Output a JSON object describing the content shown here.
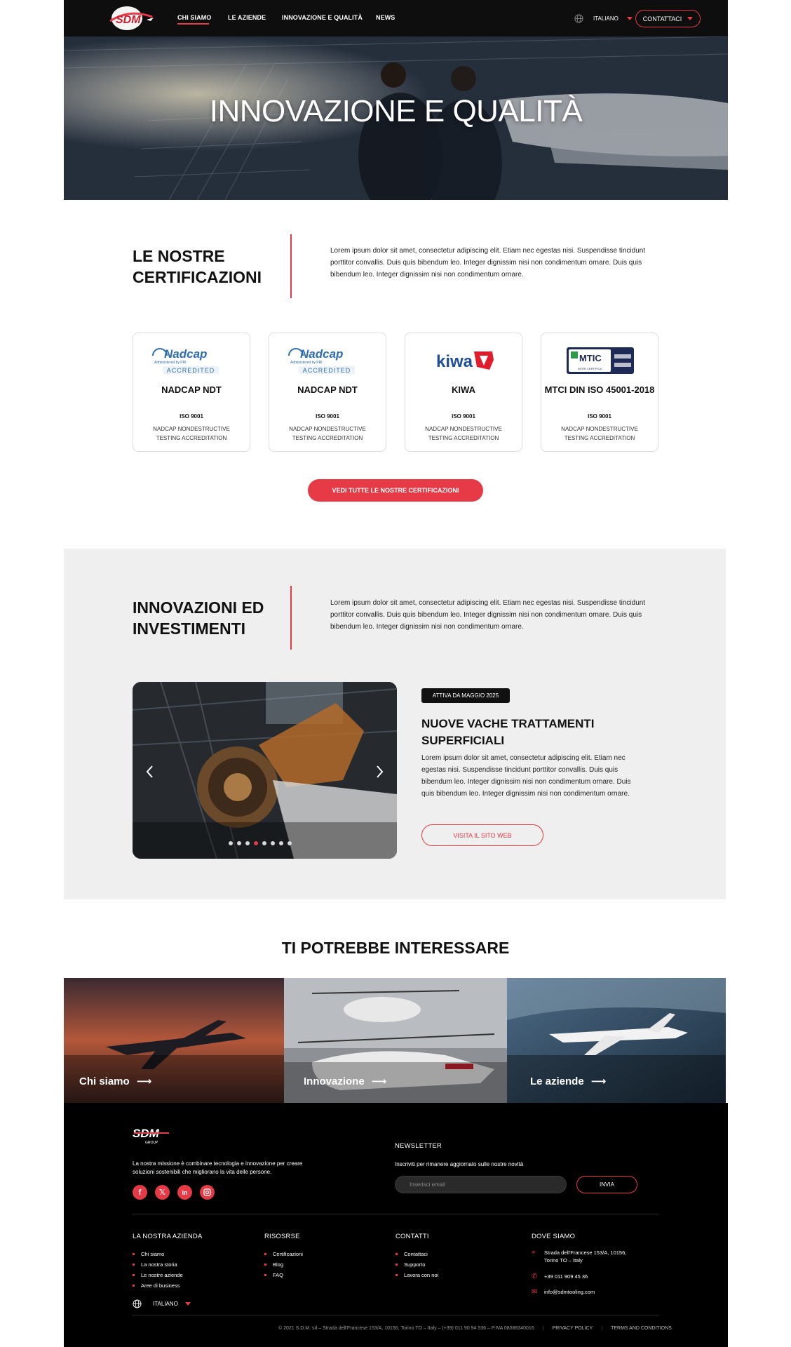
{
  "header": {
    "nav": [
      "CHI SIAMO",
      "LE AZIENDE",
      "INNOVAZIONE E QUALITÀ",
      "NEWS"
    ],
    "language": "ITALIANO",
    "contact_label": "CONTATTACI"
  },
  "hero": {
    "title": "INNOVAZIONE E QUALITÀ"
  },
  "certifications": {
    "title_line1": "LE NOSTRE",
    "title_line2": "CERTIFICAZIONI",
    "lead": "Lorem ipsum dolor sit amet, consectetur adipiscing elit. Etiam nec egestas nisi. Suspendisse tincidunt porttitor convallis. Duis quis bibendum leo. Integer dignissim nisi non condimentum ornare.  Duis quis bibendum leo. Integer dignissim nisi non condimentum ornare.",
    "cards": [
      {
        "logo_text": "Nadcap",
        "logo_sub": "Administered by PRI",
        "logo_badge": "ACCREDITED",
        "name": "NADCAP NDT",
        "iso": "ISO 9001",
        "desc": "NADCAP NONDESTRUCTIVE TESTING ACCREDITATION"
      },
      {
        "logo_text": "Nadcap",
        "logo_sub": "Administered by PRI",
        "logo_badge": "ACCREDITED",
        "name": "NADCAP NDT",
        "iso": "ISO 9001",
        "desc": "NADCAP NONDESTRUCTIVE TESTING ACCREDITATION"
      },
      {
        "logo_text": "kiwa",
        "name": "KIWA",
        "iso": "ISO 9001",
        "desc": "NADCAP NONDESTRUCTIVE TESTING ACCREDITATION"
      },
      {
        "logo_text": "MTIC",
        "logo_sub": "INTER CERTIFICA",
        "name": "MTCI DIN ISO 45001-2018",
        "iso": "ISO 9001",
        "desc": "NADCAP NONDESTRUCTIVE TESTING ACCREDITATION"
      }
    ],
    "all_button": "VEDI TUTTE LE NOSTRE CERTIFICAZIONI"
  },
  "innovation": {
    "title_line1": "INNOVAZIONI ED",
    "title_line2": "INVESTIMENTI",
    "lead": "Lorem ipsum dolor sit amet, consectetur adipiscing elit. Etiam nec egestas nisi. Suspendisse tincidunt porttitor convallis. Duis quis bibendum leo. Integer dignissim nisi non condimentum ornare.  Duis quis bibendum leo. Integer dignissim nisi non condimentum ornare.",
    "badge": "ATTIVA DA MAGGIO 2025",
    "news_title": "NUOVE VACHE TRATTAMENTI SUPERFICIALI",
    "news_text": "Lorem ipsum dolor sit amet, consectetur adipiscing elit. Etiam nec egestas nisi. Suspendisse tincidunt porttitor convallis. Duis quis bibendum leo. Integer dignissim nisi non condimentum ornare.  Duis quis bibendum leo. Integer dignissim nisi non condimentum ornare.",
    "news_button": "VISITA IL  SITO WEB",
    "slides_count": 8,
    "active_slide": 4
  },
  "interest": {
    "title": "TI POTREBBE INTERESSARE",
    "tiles": [
      "Chi siamo",
      "Innovazione",
      "Le aziende"
    ]
  },
  "footer": {
    "logo_text": "SDM",
    "logo_sub": "GROUP",
    "mission": "La nostra missione è combinare tecnologia e innovazione per creare soluzioni sostenibili che migliorano la vita delle persone.",
    "social": [
      "f",
      "X",
      "in",
      "ig"
    ],
    "newsletter_title": "NEWSLETTER",
    "newsletter_text": "Inscriviti per rimanere aggiornato sulle nostre novità",
    "newsletter_placeholder": "Inserisci email",
    "newsletter_button": "INVIA",
    "col1_title": "LA NOSTRA AZIENDA",
    "col1": [
      "Chi siamo",
      "La nostra storia",
      "Le nostre aziende",
      "Aree di business"
    ],
    "col2_title": "RISOSRSE",
    "col2": [
      "Certificazioni",
      "Blog",
      "FAQ"
    ],
    "col3_title": "CONTATTI",
    "col3": [
      "Contattaci",
      "Supporto",
      "Lavora con noi"
    ],
    "col4_title": "DOVE SIAMO",
    "address_line1": "Strada dell'Francese 153/A, 10156,",
    "address_line2": "Torino TO – Italy",
    "phone": "+39 011 909 45 36",
    "email": "info@sdmtooling.com",
    "language": "ITALIANO",
    "copyright": "© 2021 S.D.M. srl – Strada dell'Francese 153/A, 10156, Torino TO – Italy – (+39) 011 90 94 536 – P.IVA 08088340016",
    "privacy": "PRIVACY POLICY",
    "terms": "TERMS AND CONDITIONS"
  },
  "colors": {
    "accent": "#e63b46",
    "dark": "#0e0e0e",
    "section_bg": "#efefef"
  }
}
